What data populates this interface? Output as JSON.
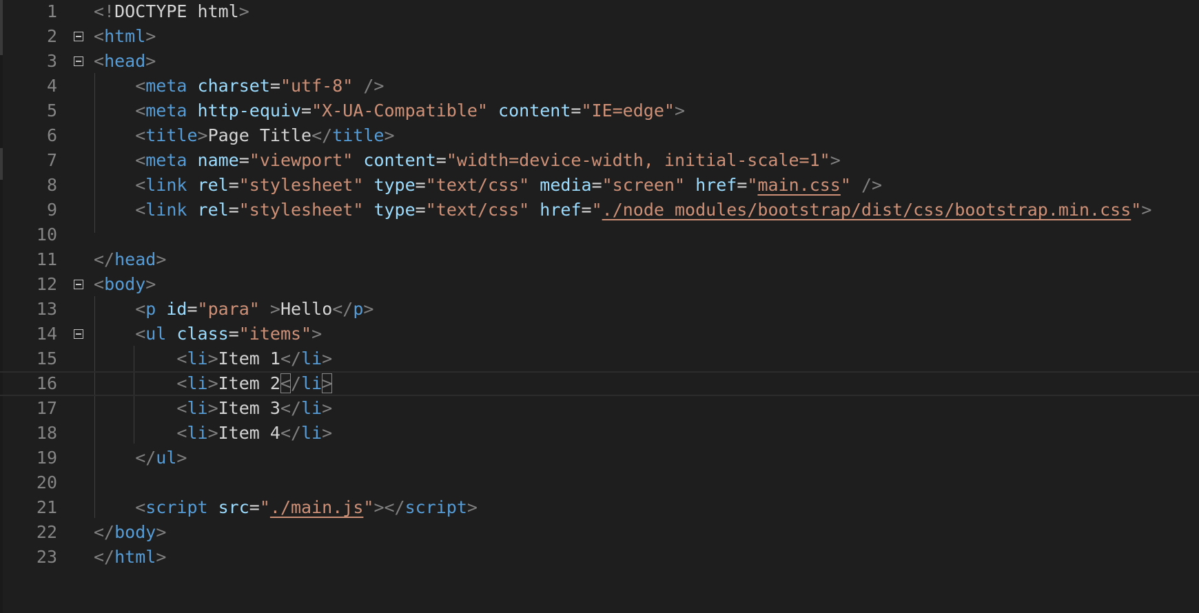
{
  "editor": {
    "lines": [
      {
        "number": "1",
        "fold": false,
        "indent": 0,
        "tokens": [
          {
            "t": "punc",
            "v": "<!"
          },
          {
            "t": "text",
            "v": "DOCTYPE html"
          },
          {
            "t": "punc",
            "v": ">"
          }
        ]
      },
      {
        "number": "2",
        "fold": true,
        "indent": 0,
        "tokens": [
          {
            "t": "punc",
            "v": "<"
          },
          {
            "t": "tag",
            "v": "html"
          },
          {
            "t": "punc",
            "v": ">"
          }
        ]
      },
      {
        "number": "3",
        "fold": true,
        "indent": 0,
        "tokens": [
          {
            "t": "punc",
            "v": "<"
          },
          {
            "t": "tag",
            "v": "head"
          },
          {
            "t": "punc",
            "v": ">"
          }
        ]
      },
      {
        "number": "4",
        "fold": false,
        "indent": 1,
        "tokens": [
          {
            "t": "punc",
            "v": "<"
          },
          {
            "t": "tag",
            "v": "meta"
          },
          {
            "t": "text",
            "v": " "
          },
          {
            "t": "attr",
            "v": "charset"
          },
          {
            "t": "text",
            "v": "="
          },
          {
            "t": "str",
            "v": "\"utf-8\""
          },
          {
            "t": "text",
            "v": " "
          },
          {
            "t": "punc",
            "v": "/>"
          }
        ]
      },
      {
        "number": "5",
        "fold": false,
        "indent": 1,
        "tokens": [
          {
            "t": "punc",
            "v": "<"
          },
          {
            "t": "tag",
            "v": "meta"
          },
          {
            "t": "text",
            "v": " "
          },
          {
            "t": "attr",
            "v": "http-equiv"
          },
          {
            "t": "text",
            "v": "="
          },
          {
            "t": "str",
            "v": "\"X-UA-Compatible\""
          },
          {
            "t": "text",
            "v": " "
          },
          {
            "t": "attr",
            "v": "content"
          },
          {
            "t": "text",
            "v": "="
          },
          {
            "t": "str",
            "v": "\"IE=edge\""
          },
          {
            "t": "punc",
            "v": ">"
          }
        ]
      },
      {
        "number": "6",
        "fold": false,
        "indent": 1,
        "tokens": [
          {
            "t": "punc",
            "v": "<"
          },
          {
            "t": "tag",
            "v": "title"
          },
          {
            "t": "punc",
            "v": ">"
          },
          {
            "t": "text",
            "v": "Page Title"
          },
          {
            "t": "punc",
            "v": "</"
          },
          {
            "t": "tag",
            "v": "title"
          },
          {
            "t": "punc",
            "v": ">"
          }
        ]
      },
      {
        "number": "7",
        "fold": false,
        "indent": 1,
        "tokens": [
          {
            "t": "punc",
            "v": "<"
          },
          {
            "t": "tag",
            "v": "meta"
          },
          {
            "t": "text",
            "v": " "
          },
          {
            "t": "attr",
            "v": "name"
          },
          {
            "t": "text",
            "v": "="
          },
          {
            "t": "str",
            "v": "\"viewport\""
          },
          {
            "t": "text",
            "v": " "
          },
          {
            "t": "attr",
            "v": "content"
          },
          {
            "t": "text",
            "v": "="
          },
          {
            "t": "str",
            "v": "\"width=device-width, initial-scale=1\""
          },
          {
            "t": "punc",
            "v": ">"
          }
        ]
      },
      {
        "number": "8",
        "fold": false,
        "indent": 1,
        "tokens": [
          {
            "t": "punc",
            "v": "<"
          },
          {
            "t": "tag",
            "v": "link"
          },
          {
            "t": "text",
            "v": " "
          },
          {
            "t": "attr",
            "v": "rel"
          },
          {
            "t": "text",
            "v": "="
          },
          {
            "t": "str",
            "v": "\"stylesheet\""
          },
          {
            "t": "text",
            "v": " "
          },
          {
            "t": "attr",
            "v": "type"
          },
          {
            "t": "text",
            "v": "="
          },
          {
            "t": "str",
            "v": "\"text/css\""
          },
          {
            "t": "text",
            "v": " "
          },
          {
            "t": "attr",
            "v": "media"
          },
          {
            "t": "text",
            "v": "="
          },
          {
            "t": "str",
            "v": "\"screen\""
          },
          {
            "t": "text",
            "v": " "
          },
          {
            "t": "attr",
            "v": "href"
          },
          {
            "t": "text",
            "v": "="
          },
          {
            "t": "str",
            "v": "\""
          },
          {
            "t": "link",
            "v": "main.css"
          },
          {
            "t": "str",
            "v": "\""
          },
          {
            "t": "text",
            "v": " "
          },
          {
            "t": "punc",
            "v": "/>"
          }
        ]
      },
      {
        "number": "9",
        "fold": false,
        "indent": 1,
        "tokens": [
          {
            "t": "punc",
            "v": "<"
          },
          {
            "t": "tag",
            "v": "link"
          },
          {
            "t": "text",
            "v": " "
          },
          {
            "t": "attr",
            "v": "rel"
          },
          {
            "t": "text",
            "v": "="
          },
          {
            "t": "str",
            "v": "\"stylesheet\""
          },
          {
            "t": "text",
            "v": " "
          },
          {
            "t": "attr",
            "v": "type"
          },
          {
            "t": "text",
            "v": "="
          },
          {
            "t": "str",
            "v": "\"text/css\""
          },
          {
            "t": "text",
            "v": " "
          },
          {
            "t": "attr",
            "v": "href"
          },
          {
            "t": "text",
            "v": "="
          },
          {
            "t": "str",
            "v": "\""
          },
          {
            "t": "link",
            "v": "./node_modules/bootstrap/dist/css/bootstrap.min.css"
          },
          {
            "t": "str",
            "v": "\""
          },
          {
            "t": "punc",
            "v": ">"
          }
        ]
      },
      {
        "number": "10",
        "fold": false,
        "indent": 0,
        "tokens": []
      },
      {
        "number": "11",
        "fold": false,
        "indent": 0,
        "tokens": [
          {
            "t": "punc",
            "v": "</"
          },
          {
            "t": "tag",
            "v": "head"
          },
          {
            "t": "punc",
            "v": ">"
          }
        ]
      },
      {
        "number": "12",
        "fold": true,
        "indent": 0,
        "tokens": [
          {
            "t": "punc",
            "v": "<"
          },
          {
            "t": "tag",
            "v": "body"
          },
          {
            "t": "punc",
            "v": ">"
          }
        ]
      },
      {
        "number": "13",
        "fold": false,
        "indent": 1,
        "tokens": [
          {
            "t": "punc",
            "v": "<"
          },
          {
            "t": "tag",
            "v": "p"
          },
          {
            "t": "text",
            "v": " "
          },
          {
            "t": "attr",
            "v": "id"
          },
          {
            "t": "text",
            "v": "="
          },
          {
            "t": "str",
            "v": "\"para\""
          },
          {
            "t": "text",
            "v": " "
          },
          {
            "t": "punc",
            "v": ">"
          },
          {
            "t": "text",
            "v": "Hello"
          },
          {
            "t": "punc",
            "v": "</"
          },
          {
            "t": "tag",
            "v": "p"
          },
          {
            "t": "punc",
            "v": ">"
          }
        ]
      },
      {
        "number": "14",
        "fold": true,
        "indent": 1,
        "tokens": [
          {
            "t": "punc",
            "v": "<"
          },
          {
            "t": "tag",
            "v": "ul"
          },
          {
            "t": "text",
            "v": " "
          },
          {
            "t": "attr",
            "v": "class"
          },
          {
            "t": "text",
            "v": "="
          },
          {
            "t": "str",
            "v": "\"items\""
          },
          {
            "t": "punc",
            "v": ">"
          }
        ]
      },
      {
        "number": "15",
        "fold": false,
        "indent": 2,
        "tokens": [
          {
            "t": "punc",
            "v": "<"
          },
          {
            "t": "tag",
            "v": "li"
          },
          {
            "t": "punc",
            "v": ">"
          },
          {
            "t": "text",
            "v": "Item 1"
          },
          {
            "t": "punc",
            "v": "</"
          },
          {
            "t": "tag",
            "v": "li"
          },
          {
            "t": "punc",
            "v": ">"
          }
        ]
      },
      {
        "number": "16",
        "fold": false,
        "indent": 2,
        "current": true,
        "tokens": [
          {
            "t": "punc",
            "v": "<"
          },
          {
            "t": "tag",
            "v": "li"
          },
          {
            "t": "punc",
            "v": ">"
          },
          {
            "t": "text",
            "v": "Item 2"
          },
          {
            "t": "bracket",
            "v": "<"
          },
          {
            "t": "punc",
            "v": "/"
          },
          {
            "t": "tag",
            "v": "li"
          },
          {
            "t": "bracket",
            "v": ">"
          }
        ]
      },
      {
        "number": "17",
        "fold": false,
        "indent": 2,
        "tokens": [
          {
            "t": "punc",
            "v": "<"
          },
          {
            "t": "tag",
            "v": "li"
          },
          {
            "t": "punc",
            "v": ">"
          },
          {
            "t": "text",
            "v": "Item 3"
          },
          {
            "t": "punc",
            "v": "</"
          },
          {
            "t": "tag",
            "v": "li"
          },
          {
            "t": "punc",
            "v": ">"
          }
        ]
      },
      {
        "number": "18",
        "fold": false,
        "indent": 2,
        "tokens": [
          {
            "t": "punc",
            "v": "<"
          },
          {
            "t": "tag",
            "v": "li"
          },
          {
            "t": "punc",
            "v": ">"
          },
          {
            "t": "text",
            "v": "Item 4"
          },
          {
            "t": "punc",
            "v": "</"
          },
          {
            "t": "tag",
            "v": "li"
          },
          {
            "t": "punc",
            "v": ">"
          }
        ]
      },
      {
        "number": "19",
        "fold": false,
        "indent": 1,
        "tokens": [
          {
            "t": "punc",
            "v": "</"
          },
          {
            "t": "tag",
            "v": "ul"
          },
          {
            "t": "punc",
            "v": ">"
          }
        ]
      },
      {
        "number": "20",
        "fold": false,
        "indent": 0,
        "tokens": []
      },
      {
        "number": "21",
        "fold": false,
        "indent": 1,
        "tokens": [
          {
            "t": "punc",
            "v": "<"
          },
          {
            "t": "tag",
            "v": "script"
          },
          {
            "t": "text",
            "v": " "
          },
          {
            "t": "attr",
            "v": "src"
          },
          {
            "t": "text",
            "v": "="
          },
          {
            "t": "str",
            "v": "\""
          },
          {
            "t": "link",
            "v": "./main.js"
          },
          {
            "t": "str",
            "v": "\""
          },
          {
            "t": "punc",
            "v": "></"
          },
          {
            "t": "tag",
            "v": "script"
          },
          {
            "t": "punc",
            "v": ">"
          }
        ]
      },
      {
        "number": "22",
        "fold": false,
        "indent": 0,
        "tokens": [
          {
            "t": "punc",
            "v": "</"
          },
          {
            "t": "tag",
            "v": "body"
          },
          {
            "t": "punc",
            "v": ">"
          }
        ]
      },
      {
        "number": "23",
        "fold": false,
        "indent": 0,
        "tokens": [
          {
            "t": "punc",
            "v": "</"
          },
          {
            "t": "tag",
            "v": "html"
          },
          {
            "t": "punc",
            "v": ">"
          }
        ]
      }
    ]
  },
  "colors": {
    "background": "#1e1e1e",
    "line_number": "#858585",
    "tag": "#569cd6",
    "attribute": "#9cdcfe",
    "string": "#ce9178",
    "punctuation": "#808080",
    "text": "#d4d4d4"
  },
  "icons": {
    "fold": "fold-collapse-icon"
  }
}
